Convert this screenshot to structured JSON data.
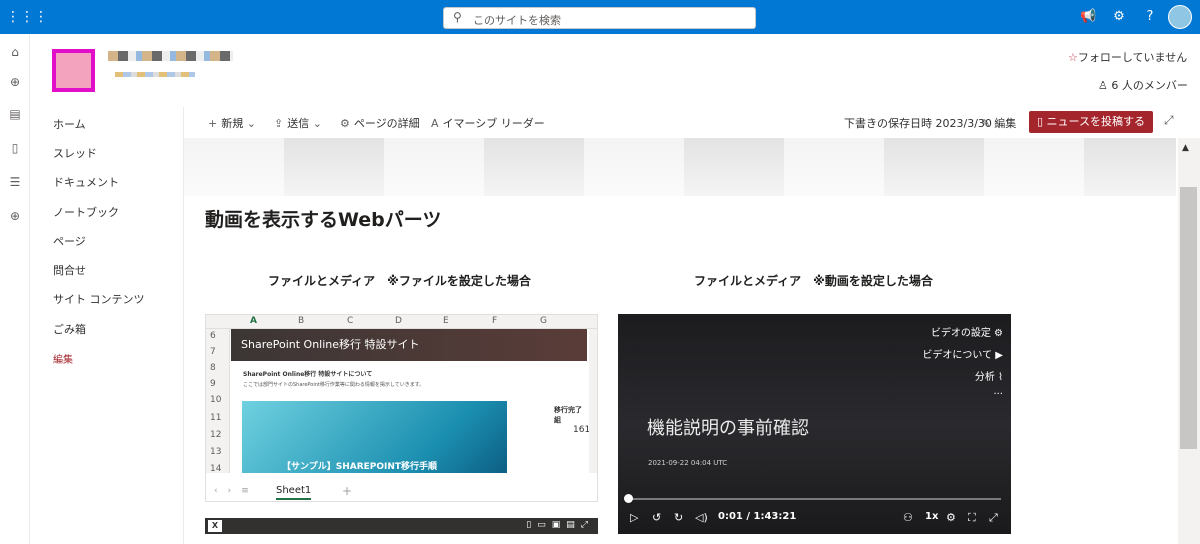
{
  "topbar": {
    "search_placeholder": "このサイトを検索"
  },
  "site": {
    "follow_label": "フォローしていません",
    "members_label": "6 人のメンバー"
  },
  "leftnav": {
    "items": [
      "ホーム",
      "スレッド",
      "ドキュメント",
      "ノートブック",
      "ページ",
      "問合せ",
      "サイト コンテンツ",
      "ごみ箱"
    ],
    "edit_label": "編集"
  },
  "cmdbar": {
    "new_label": "新規",
    "send_label": "送信",
    "details_label": "ページの詳細",
    "immersive_label": "イマーシブ リーダー",
    "saved_label": "下書きの保存日時 2023/3/30",
    "edit_label": "編集",
    "post_news_label": "ニュースを投稿する"
  },
  "page": {
    "title": "動画を表示するWebパーツ",
    "left_heading": "ファイルとメディア　※ファイルを設定した場合",
    "right_heading": "ファイルとメディア　※動画を設定した場合"
  },
  "excel": {
    "columns": [
      "A",
      "B",
      "C",
      "D",
      "E",
      "F",
      "G"
    ],
    "rows": [
      "6",
      "7",
      "8",
      "9",
      "10",
      "11",
      "12",
      "13",
      "14"
    ],
    "embed_header": "SharePoint Online移行 特設サイト",
    "embed_line1": "SharePoint Online移行 特設サイトについて",
    "embed_line2": "ここでは部門サイトのSharePoint移行作業等に関わる情報を掲示していきます。",
    "banner_text": "【サンプル】SHAREPOINT移行手順",
    "side_label": "移行完了組",
    "side_value": "161",
    "sheet_tab": "Sheet1"
  },
  "video": {
    "menu": [
      "ビデオの設定",
      "ビデオについて",
      "分析",
      "..."
    ],
    "title": "機能説明の事前確認",
    "date": "2021-09-22 04:04 UTC",
    "time": "0:01 / 1:43:21",
    "speed": "1x"
  }
}
